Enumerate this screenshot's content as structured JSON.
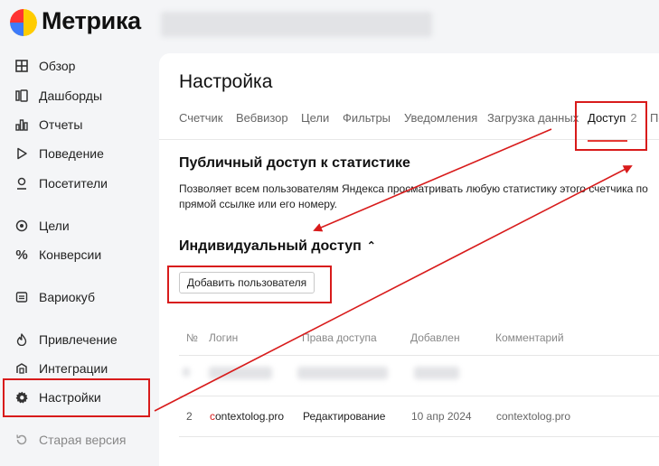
{
  "app": {
    "logo_text": "Метрика"
  },
  "sidebar": {
    "items": [
      {
        "label": "Обзор"
      },
      {
        "label": "Дашборды"
      },
      {
        "label": "Отчеты"
      },
      {
        "label": "Поведение"
      },
      {
        "label": "Посетители"
      },
      {
        "label": "Цели"
      },
      {
        "label": "Конверсии"
      },
      {
        "label": "Вариокуб"
      },
      {
        "label": "Привлечение"
      },
      {
        "label": "Интеграции"
      },
      {
        "label": "Настройки"
      },
      {
        "label": "Старая версия"
      }
    ]
  },
  "main": {
    "title": "Настройка",
    "tabs": [
      {
        "label": "Счетчик"
      },
      {
        "label": "Вебвизор"
      },
      {
        "label": "Цели"
      },
      {
        "label": "Фильтры"
      },
      {
        "label": "Уведомления"
      },
      {
        "label": "Загрузка данных"
      },
      {
        "label": "Доступ",
        "count": "2"
      },
      {
        "label": "По"
      }
    ],
    "public_access": {
      "title": "Публичный доступ к статистике",
      "description": "Позволяет всем пользователям Яндекса просматривать любую статистику этого счетчика по прямой ссылке или его номеру."
    },
    "individual_access": {
      "title": "Индивидуальный доступ",
      "add_button": "Добавить пользователя",
      "table": {
        "columns": [
          "№",
          "Логин",
          "Права доступа",
          "Добавлен",
          "Комментарий"
        ],
        "rows": [
          {
            "num": "2",
            "login_first": "c",
            "login_rest": "ontextolog.pro",
            "rights": "Редактирование",
            "added": "10 апр 2024",
            "comment": "contextolog.pro"
          }
        ]
      }
    }
  },
  "colors": {
    "accent_red": "#d81b1b",
    "active_underline": "#e53935"
  }
}
